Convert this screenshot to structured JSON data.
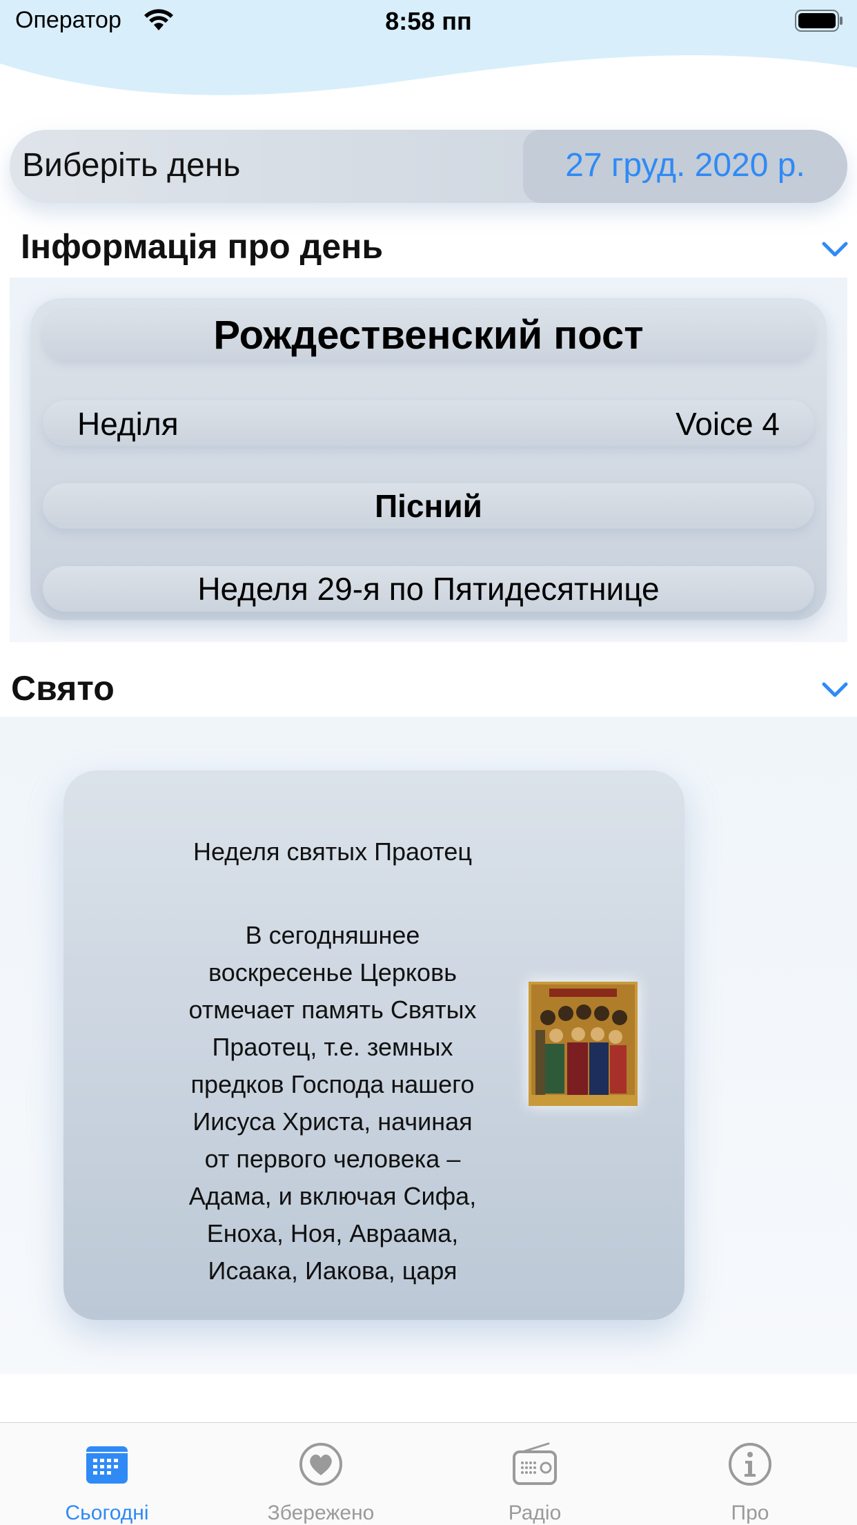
{
  "status_bar": {
    "carrier": "Оператор",
    "time": "8:58 пп",
    "wifi_icon": "wifi-icon",
    "battery_icon": "battery-icon"
  },
  "date_picker": {
    "label": "Виберіть день",
    "value": "27 груд. 2020 р."
  },
  "day_info": {
    "title": "Інформація про день",
    "fast_name": "Рождественский пост",
    "weekday": "Неділя",
    "voice": "Voice 4",
    "type": "Пісний",
    "week_name": "Неделя 29-я по Пятидесятнице"
  },
  "holiday": {
    "title": "Свято",
    "feast_title": "Неделя святых Праотец",
    "text": "В сегодняшнее\nвоскресенье Церковь\nотмечает память Святых\nПраотец, т.е. земных\nпредков Господа нашего\nИисуса Христа, начиная\nот первого человека –\nАдама, и включая Сифа,\nЕноха, Ноя, Авраама,\nИсаака, Иакова, царя",
    "image_icon": "icon-image"
  },
  "tabs": [
    {
      "label": "Сьогодні",
      "icon": "calendar-icon",
      "active": true
    },
    {
      "label": "Збережено",
      "icon": "heart-icon",
      "active": false
    },
    {
      "label": "Радіо",
      "icon": "radio-icon",
      "active": false
    },
    {
      "label": "Про",
      "icon": "info-icon",
      "active": false
    }
  ],
  "colors": {
    "accent": "#2f8af5",
    "inactive_tab": "#9a9a9a",
    "header_wave": "#d8eefb"
  }
}
